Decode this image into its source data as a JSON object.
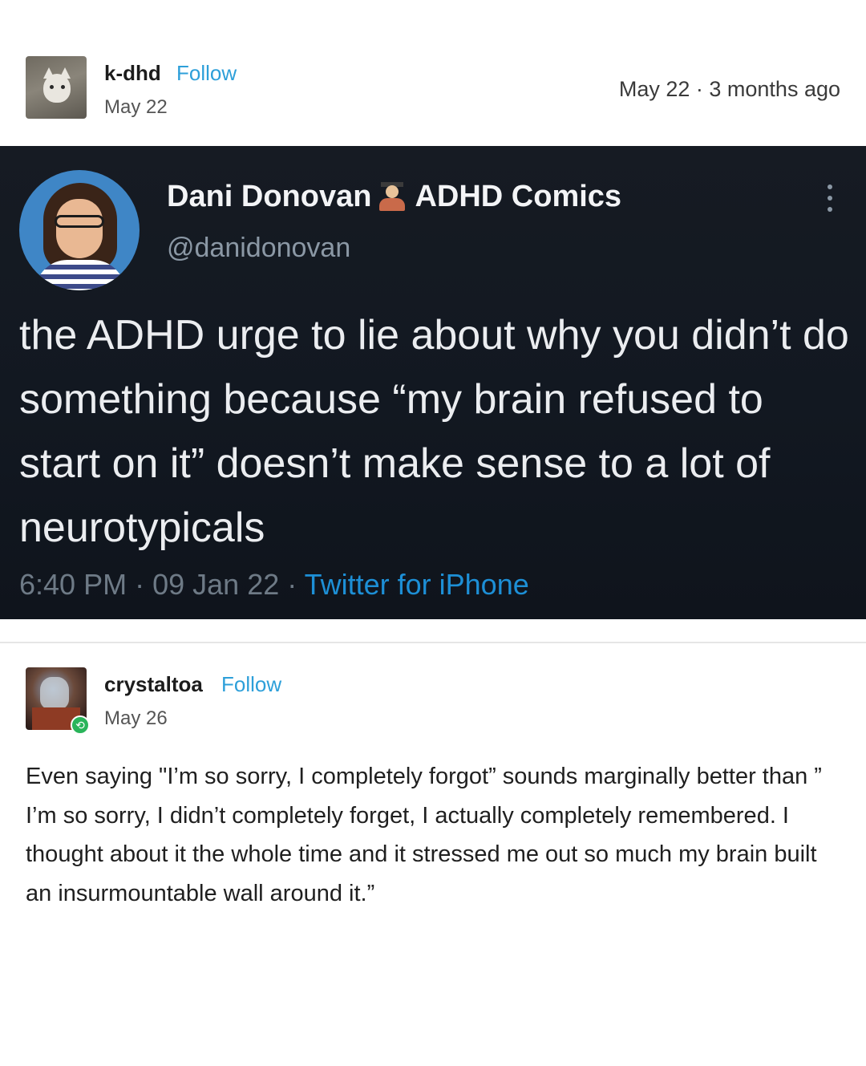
{
  "post": {
    "username": "k-dhd",
    "follow_label": "Follow",
    "date": "May 22",
    "meta_right": "May 22 · 3 months ago"
  },
  "tweet": {
    "display_name": "Dani Donovan",
    "name_suffix": "ADHD Comics",
    "emoji": "teacher-emoji",
    "handle": "@danidonovan",
    "text": "the ADHD urge to lie about why you didn’t do something because “my brain refused to start on it” doesn’t make sense to a lot of neurotypicals",
    "time": "6:40 PM",
    "date": "09 Jan 22",
    "separator": "·",
    "source": "Twitter for iPhone"
  },
  "reblog": {
    "username": "crystaltoa",
    "follow_label": "Follow",
    "date": "May 26",
    "text": "Even saying \"I’m so sorry, I completely forgot” sounds marginally better than ” I’m so sorry, I didn’t completely forget, I actually completely remembered. I thought about it the whole time and it stressed me out so much my brain built an insurmountable wall around it.”"
  },
  "colors": {
    "follow": "#2d9fd9",
    "tweet_bg": "#141a22",
    "tweet_source": "#1d8fd6",
    "reblog_badge": "#29b45a"
  }
}
